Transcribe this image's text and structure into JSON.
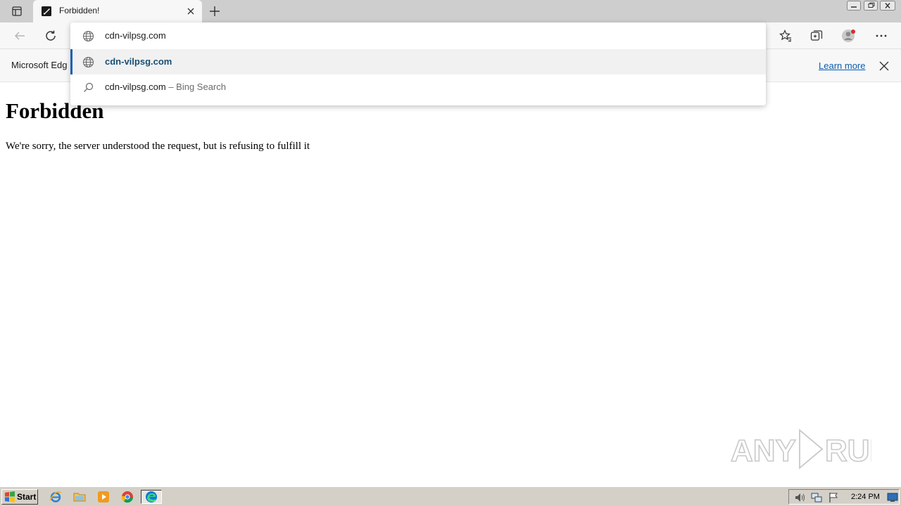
{
  "browser": {
    "tab": {
      "title": "Forbidden!",
      "favicon": "page-icon"
    },
    "address": {
      "typed_value": "cdn-vilpsg.com",
      "suggestions": [
        {
          "icon": "globe-icon",
          "text": "cdn-vilpsg.com",
          "suffix": ""
        },
        {
          "icon": "search-icon",
          "text": "cdn-vilpsg.com",
          "suffix": "– Bing Search"
        }
      ]
    },
    "infobar": {
      "text": "Microsoft Edg",
      "link": "Learn more"
    }
  },
  "page": {
    "heading": "Forbidden",
    "message": "We're sorry, the server understood the request, but is refusing to fulfill it"
  },
  "watermark": {
    "text": "ANY RUN"
  },
  "taskbar": {
    "start_label": "Start",
    "apps": [
      "internet-explorer-icon",
      "folder-icon",
      "media-player-icon",
      "chrome-icon",
      "edge-icon"
    ],
    "clock": "2:24 PM"
  },
  "colors": {
    "accent": "#1a5fb4",
    "link": "#0b5cad",
    "taskbar": "#d4d0c8"
  }
}
